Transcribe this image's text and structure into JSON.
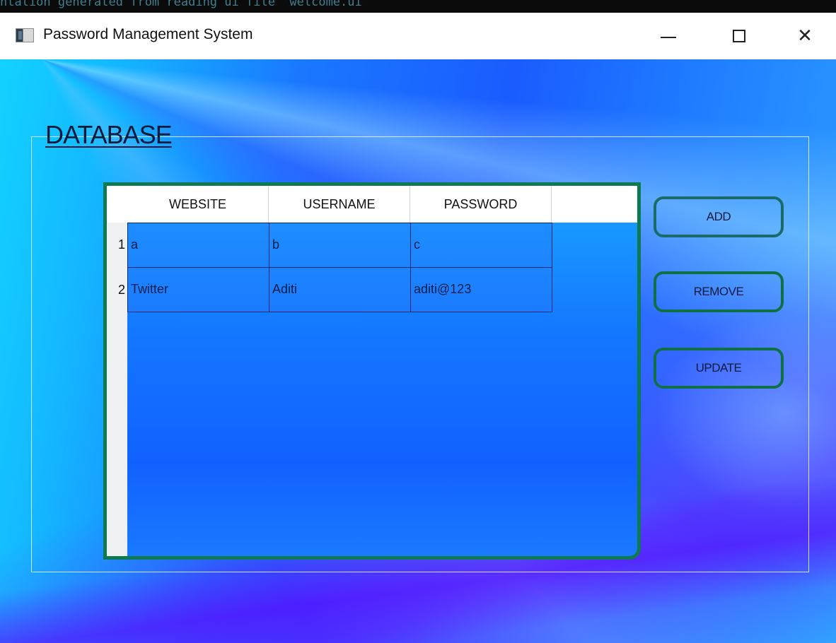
{
  "terminal_strip": {
    "text": "ntation generated from reading ui file 'welcome.ui'"
  },
  "window": {
    "title": "Password Management System",
    "icon": "app-window-icon",
    "controls": {
      "minimize": "minimize-icon",
      "maximize": "maximize-icon",
      "close": "close-icon"
    }
  },
  "group": {
    "title": "DATABASE"
  },
  "table": {
    "columns": [
      "WEBSITE",
      "USERNAME",
      "PASSWORD"
    ],
    "rows": [
      {
        "num": "1",
        "cells": [
          "a",
          "b",
          "c"
        ]
      },
      {
        "num": "2",
        "cells": [
          "Twitter",
          "Aditi",
          "aditi@123"
        ]
      }
    ]
  },
  "buttons": {
    "add": "ADD",
    "remove": "REMOVE",
    "update": "UPDATE"
  },
  "colors": {
    "button_border": "#0f7048",
    "table_border": "#0e7a52",
    "background_primary": "#1a5cff",
    "background_accent": "#7a14ff"
  }
}
